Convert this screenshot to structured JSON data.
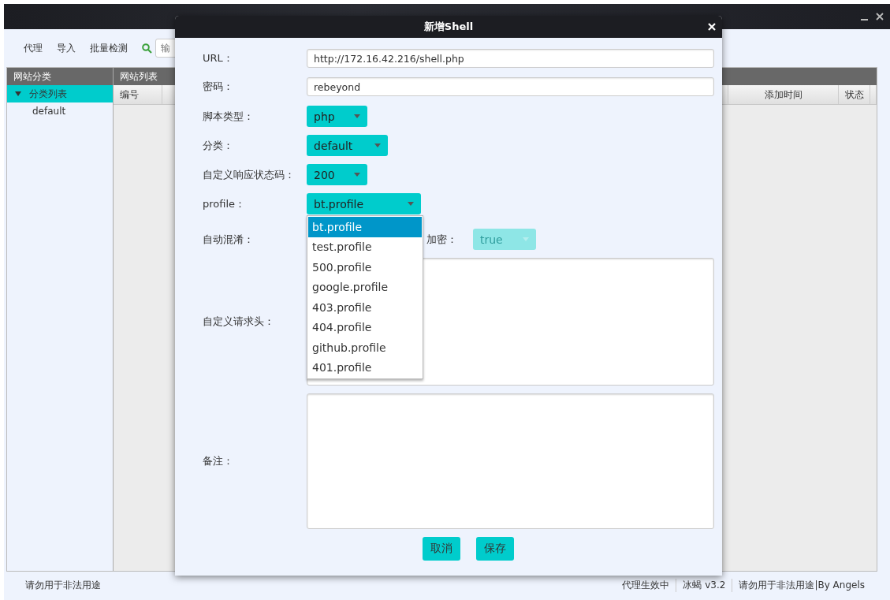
{
  "main_window": {
    "toolbar": {
      "items": [
        "代理",
        "导入",
        "批量检测"
      ],
      "search": {
        "placeholder": "输"
      }
    },
    "sidebar": {
      "title": "网站分类",
      "tree": [
        {
          "label": "分类列表",
          "expanded": true,
          "selected": true,
          "children": [
            {
              "label": "default",
              "selected": false
            }
          ]
        }
      ]
    },
    "table": {
      "title": "网站列表",
      "columns": [
        "编号",
        "",
        "添加时间",
        "状态"
      ]
    },
    "status_bar": {
      "left": "请勿用于非法用途",
      "right": [
        "代理生效中",
        "冰蝎 v3.2",
        "请勿用于非法用途|By Angels"
      ]
    }
  },
  "dialog": {
    "title": "新增Shell",
    "fields": [
      {
        "kind": "text",
        "label": "URL：",
        "value": "http://172.16.42.216/shell.php"
      },
      {
        "kind": "text",
        "label": "密码：",
        "value": "rebeyond"
      },
      {
        "kind": "select",
        "label": "脚本类型：",
        "value": "php",
        "open": false
      },
      {
        "kind": "select",
        "label": "分类：",
        "value": "default",
        "open": false
      },
      {
        "kind": "select",
        "label": "自定义响应状态码：",
        "value": "200",
        "open": false
      },
      {
        "kind": "select",
        "label": "profile：",
        "value": "bt.profile",
        "open": true,
        "options": [
          {
            "label": "bt.profile",
            "selected": true
          },
          {
            "label": "test.profile",
            "selected": false
          },
          {
            "label": "500.profile",
            "selected": false
          },
          {
            "label": "google.profile",
            "selected": false
          },
          {
            "label": "403.profile",
            "selected": false
          },
          {
            "label": "404.profile",
            "selected": false
          },
          {
            "label": "github.profile",
            "selected": false
          },
          {
            "label": "401.profile",
            "selected": false
          }
        ]
      },
      {
        "kind": "pair",
        "label": "自动混淆：",
        "second_label": "加密：",
        "second_value": "true",
        "second_disabled": true
      },
      {
        "kind": "textarea",
        "label": "自定义请求头："
      },
      {
        "kind": "textarea",
        "label": "备注："
      }
    ],
    "buttons": [
      "取消",
      "保存"
    ]
  }
}
